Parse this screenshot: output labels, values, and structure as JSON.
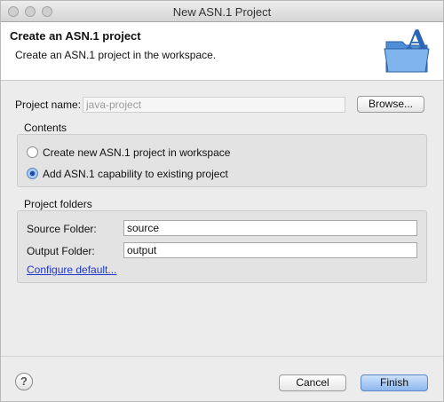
{
  "window": {
    "title": "New ASN.1 Project"
  },
  "banner": {
    "title": "Create an ASN.1 project",
    "subtitle": "Create an ASN.1 project in the workspace."
  },
  "project_name": {
    "label": "Project name:",
    "value": "java-project",
    "browse": "Browse..."
  },
  "contents": {
    "title": "Contents",
    "option_new": "Create new ASN.1 project in workspace",
    "option_existing": "Add ASN.1 capability to existing project",
    "selected": "option_existing"
  },
  "folders": {
    "title": "Project folders",
    "source_label": "Source Folder:",
    "source_value": "source",
    "output_label": "Output Folder:",
    "output_value": "output",
    "configure_link": "Configure default..."
  },
  "footer": {
    "help": "?",
    "cancel": "Cancel",
    "finish": "Finish"
  },
  "icons": {
    "traffic_lights": "window-control-icons",
    "banner": "folder-letter-a-icon",
    "help": "help-icon"
  }
}
